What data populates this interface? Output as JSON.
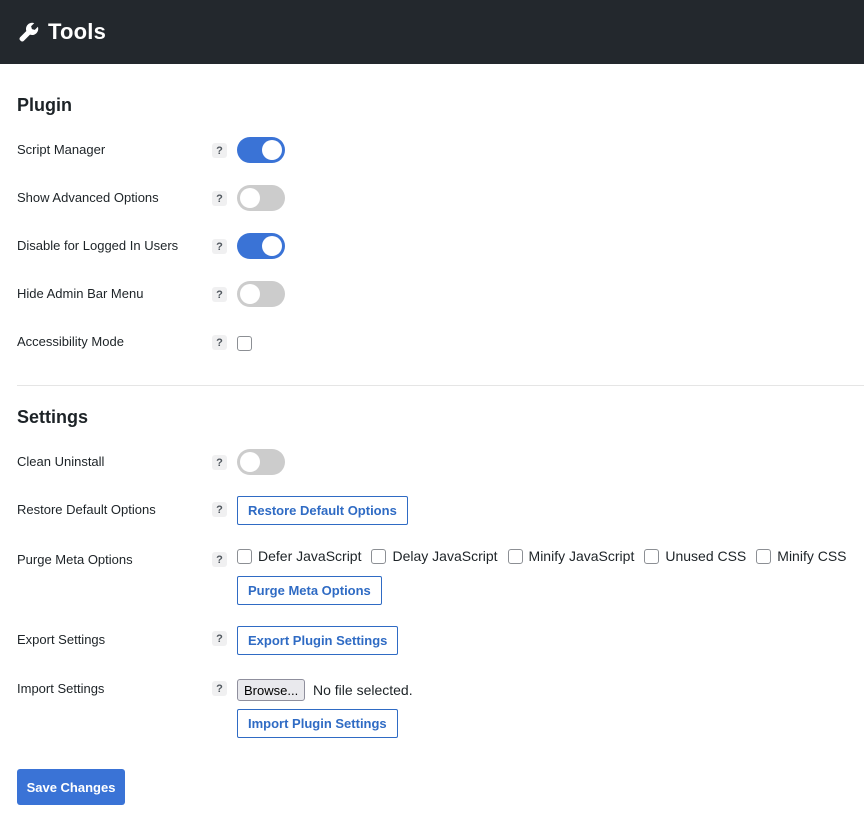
{
  "header": {
    "title": "Tools",
    "icon": "wrench-icon"
  },
  "plugin": {
    "title": "Plugin",
    "rows": [
      {
        "label": "Script Manager",
        "type": "toggle",
        "on": true
      },
      {
        "label": "Show Advanced Options",
        "type": "toggle",
        "on": false
      },
      {
        "label": "Disable for Logged In Users",
        "type": "toggle",
        "on": true
      },
      {
        "label": "Hide Admin Bar Menu",
        "type": "toggle",
        "on": false
      },
      {
        "label": "Accessibility Mode",
        "type": "checkbox",
        "checked": false
      }
    ]
  },
  "settings": {
    "title": "Settings",
    "clean_uninstall": {
      "label": "Clean Uninstall",
      "on": false
    },
    "restore_defaults": {
      "label": "Restore Default Options",
      "button": "Restore Default Options"
    },
    "purge_meta": {
      "label": "Purge Meta Options",
      "options": [
        "Defer JavaScript",
        "Delay JavaScript",
        "Minify JavaScript",
        "Unused CSS",
        "Minify CSS"
      ],
      "button": "Purge Meta Options"
    },
    "export": {
      "label": "Export Settings",
      "button": "Export Plugin Settings"
    },
    "import": {
      "label": "Import Settings",
      "browse": "Browse...",
      "file_status": "No file selected.",
      "button": "Import Plugin Settings"
    }
  },
  "help_glyph": "?",
  "save_label": "Save Changes",
  "colors": {
    "header_bg": "#23282d",
    "accent": "#3a73d6",
    "toggle_off": "#cccccc",
    "button_outline": "#2f6bc4"
  }
}
